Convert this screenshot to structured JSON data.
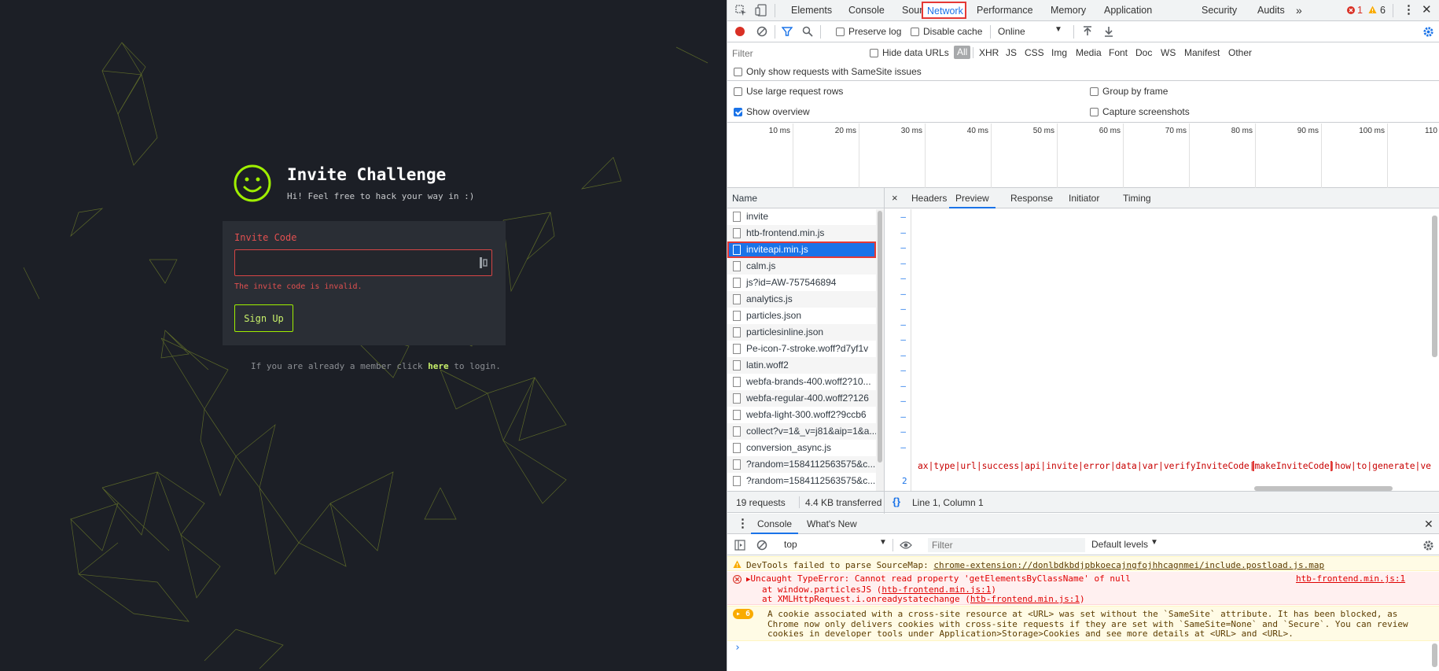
{
  "page": {
    "brand_title": "Invite Challenge",
    "brand_subtitle": "Hi! Feel free to hack your way in :)",
    "invite_label": "Invite Code",
    "invite_value": "",
    "invite_error": "The invite code is invalid.",
    "signup_label": "Sign Up",
    "login_prefix": "If you are already a member click",
    "login_link": "here",
    "login_suffix": "to login.",
    "accent_color": "#9fef00",
    "error_color": "#e25050"
  },
  "devtools": {
    "tabs": [
      "Elements",
      "Console",
      "Sources",
      "Network",
      "Performance",
      "Memory",
      "Application",
      "Security",
      "Audits"
    ],
    "active_tab": "Network",
    "more_tabs_icon": "double-chevron-right-icon",
    "error_count": "1",
    "warning_count": "6",
    "network_toolbar": {
      "preserve_log": "Preserve log",
      "disable_cache": "Disable cache",
      "throttle": "Online"
    },
    "filter": {
      "placeholder": "Filter",
      "hide_data_urls": "Hide data URLs",
      "types": [
        "All",
        "XHR",
        "JS",
        "CSS",
        "Img",
        "Media",
        "Font",
        "Doc",
        "WS",
        "Manifest",
        "Other"
      ],
      "samesite_only": "Only show requests with SameSite issues"
    },
    "options": {
      "large_rows": "Use large request rows",
      "group_by_frame": "Group by frame",
      "show_overview": "Show overview",
      "capture_screenshots": "Capture screenshots"
    },
    "timeline_ticks": [
      "10 ms",
      "20 ms",
      "30 ms",
      "40 ms",
      "50 ms",
      "60 ms",
      "70 ms",
      "80 ms",
      "90 ms",
      "100 ms",
      "110"
    ],
    "request_list": {
      "header": "Name",
      "items": [
        "invite",
        "htb-frontend.min.js",
        "inviteapi.min.js",
        "calm.js",
        "js?id=AW-757546894",
        "analytics.js",
        "particles.json",
        "particlesinline.json",
        "Pe-icon-7-stroke.woff?d7yf1v",
        "latin.woff2",
        "webfa-brands-400.woff2?10...",
        "webfa-regular-400.woff2?126",
        "webfa-light-300.woff2?9ccb6",
        "collect?v=1&_v=j81&aip=1&a...",
        "conversion_async.js",
        "?random=1584112563575&c...",
        "?random=1584112563575&c..."
      ],
      "selected": "inviteapi.min.js"
    },
    "detail_tabs": [
      "Headers",
      "Preview",
      "Response",
      "Initiator",
      "Timing"
    ],
    "active_detail_tab": "Preview",
    "code": {
      "before": "ax|type|url|success|api|invite|error|data|var|verifyInviteCode",
      "highlight": "makeInviteCode",
      "after": "how|to|generate|verif",
      "line2_number": "2"
    },
    "status": {
      "requests": "19 requests",
      "transferred": "4.4 KB transferred",
      "position": "Line 1, Column 1"
    },
    "drawer": {
      "tabs": [
        "Console",
        "What's New"
      ],
      "context": "top",
      "filter_placeholder": "Filter",
      "levels": "Default levels",
      "messages": {
        "warn1_text": "DevTools failed to parse SourceMap:",
        "warn1_link": "chrome-extension://donlbdkbdjpbkoecajngfojhhcagnmei/include.postload.js.map",
        "err_text": "Uncaught TypeError: Cannot read property 'getElementsByClassName' of null",
        "err_source": "htb-frontend.min.js:1",
        "err_stack1_prefix": "at window.particlesJS (",
        "err_stack1_link": "htb-frontend.min.js:1",
        "err_stack2_prefix": "at XMLHttpRequest.i.onreadystatechange (",
        "err_stack2_link": "htb-frontend.min.js:1",
        "stack_suffix": ")",
        "warn2_count": "6",
        "warn2_line1": "A cookie associated with a cross-site resource at <URL> was set without the `SameSite` attribute. It has been blocked, as",
        "warn2_line2": "Chrome now only delivers cookies with cross-site requests if they are set with `SameSite=None` and `Secure`. You can review",
        "warn2_line3": "cookies in developer tools under Application>Storage>Cookies and see more details at <URL> and <URL>."
      }
    }
  }
}
